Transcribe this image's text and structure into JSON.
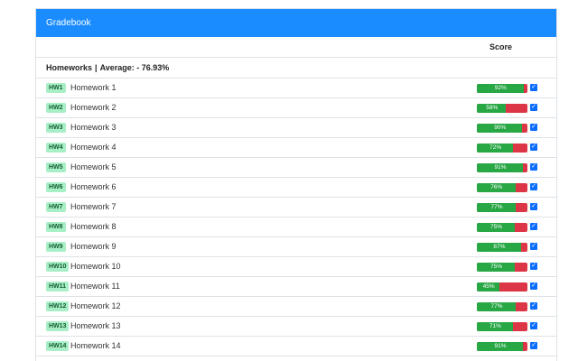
{
  "header": {
    "title": "Gradebook"
  },
  "table": {
    "score_label": "Score"
  },
  "section": {
    "name": "Homeworks",
    "separator": "|",
    "average_label": "Average: - 76.93%"
  },
  "colors": {
    "header_bg": "#1a8cff",
    "bar_pass": "#28a745",
    "bar_fail": "#dc3545",
    "badge_bg": "#a8efc7",
    "checkbox": "#0a6dfd"
  },
  "checkbox_icon": "check-icon",
  "rows": [
    {
      "badge": "HW1",
      "name": "Homework 1",
      "score": 92,
      "label": "92%",
      "checked": true
    },
    {
      "badge": "HW2",
      "name": "Homework 2",
      "score": 58,
      "label": "58%",
      "checked": true
    },
    {
      "badge": "HW3",
      "name": "Homework 3",
      "score": 90,
      "label": "90%",
      "checked": true
    },
    {
      "badge": "HW4",
      "name": "Homework 4",
      "score": 72,
      "label": "72%",
      "checked": true
    },
    {
      "badge": "HW5",
      "name": "Homework 5",
      "score": 91,
      "label": "91%",
      "checked": true
    },
    {
      "badge": "HW6",
      "name": "Homework 6",
      "score": 76,
      "label": "76%",
      "checked": true
    },
    {
      "badge": "HW7",
      "name": "Homework 7",
      "score": 77,
      "label": "77%",
      "checked": true
    },
    {
      "badge": "HW8",
      "name": "Homework 8",
      "score": 75,
      "label": "75%",
      "checked": true
    },
    {
      "badge": "HW9",
      "name": "Homework 9",
      "score": 87,
      "label": "87%",
      "checked": true
    },
    {
      "badge": "HW10",
      "name": "Homework 10",
      "score": 75,
      "label": "75%",
      "checked": true
    },
    {
      "badge": "HW11",
      "name": "Homework 11",
      "score": 45,
      "label": "45%",
      "checked": true
    },
    {
      "badge": "HW12",
      "name": "Homework 12",
      "score": 77,
      "label": "77%",
      "checked": true
    },
    {
      "badge": "HW13",
      "name": "Homework 13",
      "score": 71,
      "label": "71%",
      "checked": true
    },
    {
      "badge": "HW14",
      "name": "Homework 14",
      "score": 91,
      "label": "91%",
      "checked": true
    }
  ]
}
